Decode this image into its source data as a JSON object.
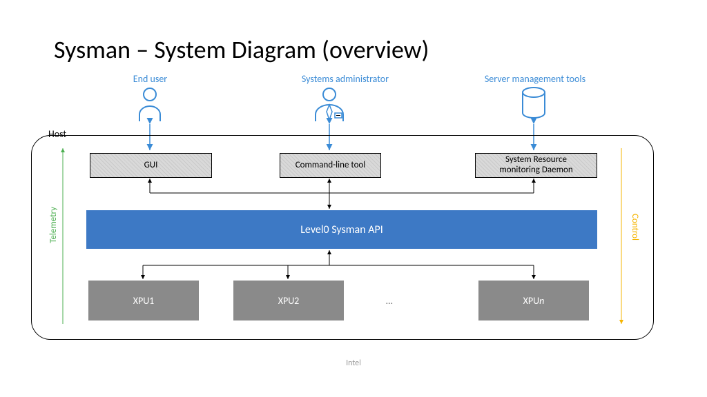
{
  "title": "Sysman – System Diagram (overview)",
  "actors": {
    "end_user": "End user",
    "sysadmin": "Systems administrator",
    "server_tools": "Server management tools"
  },
  "host_label": "Host",
  "top_boxes": {
    "gui": "GUI",
    "cli": "Command-line tool",
    "daemon_line1": "System Resource",
    "daemon_line2": "monitoring Daemon"
  },
  "api_box": "Level0 Sysman API",
  "xpu": {
    "xpu1": "XPU1",
    "xpu2": "XPU2",
    "xpun_prefix": "XPU",
    "xpun_suffix": "n",
    "ellipsis": "…"
  },
  "side": {
    "telemetry": "Telemetry",
    "control": "Control"
  },
  "footer": "Intel"
}
